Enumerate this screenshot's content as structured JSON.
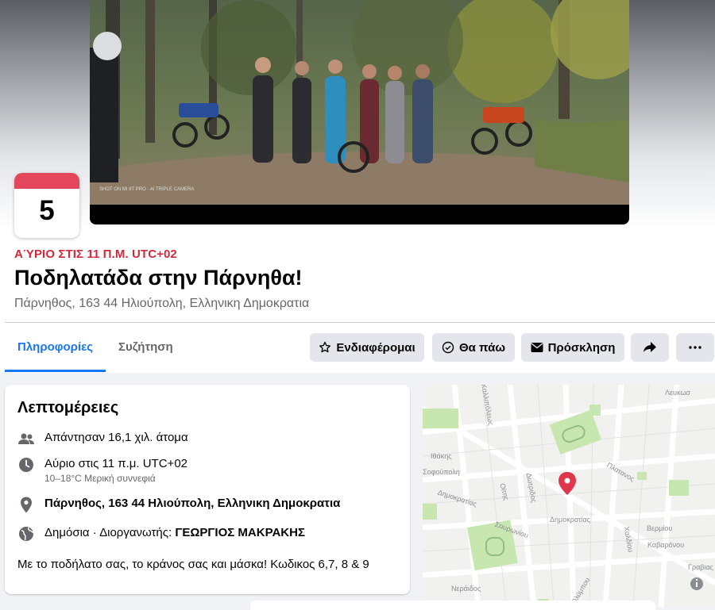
{
  "event": {
    "day": "5",
    "when": "ΑΎΡΙΟ ΣΤΙΣ 11 Π.Μ. UTC+02",
    "title": "Ποδηλατάδα στην Πάρνηθα!",
    "location": "Πάρνηθος, 163 44 Ηλιούπολη, Ελληνικη Δημοκρατια",
    "badge_color": "#e4475b",
    "when_color": "#d3283c"
  },
  "tabs": [
    {
      "label": "Πληροφορίες",
      "active": true
    },
    {
      "label": "Συζήτηση",
      "active": false
    }
  ],
  "actions": {
    "interested": "Ενδιαφέρομαι",
    "going": "Θα πάω",
    "invite": "Πρόσκληση",
    "share_icon": "share-arrow-icon",
    "more_icon": "more-dots-icon"
  },
  "details": {
    "heading": "Λεπτομέρειες",
    "responses": "Απάντησαν 16,1 χιλ. άτομα",
    "time": "Αύριο στις 11 π.μ. UTC+02",
    "weather": "10–18°C Μερική συννεφιά",
    "address": "Πάρνηθος, 163 44 Ηλιούπολη, Ελληνικη Δημοκρατια",
    "privacy_prefix": "Δημόσια · Διοργανωτής: ",
    "organizer": "ΓΕΩΡΓΙΟΣ ΜΑΚΡΑΚΗΣ",
    "description": "Με το ποδήλατο σας, το κράνος σας και μάσκα! Κωδικος 6,7, 8 & 9"
  },
  "map": {
    "labels": [
      "Καλλιπόλεως",
      "Λευκωσ",
      "Ιθάκης",
      "Σοφούπολη",
      "Οίτης",
      "Δωτριδος",
      "Πλατανος",
      "Δημοκρατίας",
      "Δημοκρατίας",
      "Σουρωνίου",
      "Χαλδίου",
      "Βερμίου",
      "Καβαρόνου",
      "Γραβιας",
      "Νεράιδος",
      "Ολύμπου"
    ],
    "pin_color": "#e0364b",
    "park_color": "#c8e6b0"
  },
  "cover_watermark": "SHOT ON MI 8T PRO · AI TRIPLE CAMERA"
}
